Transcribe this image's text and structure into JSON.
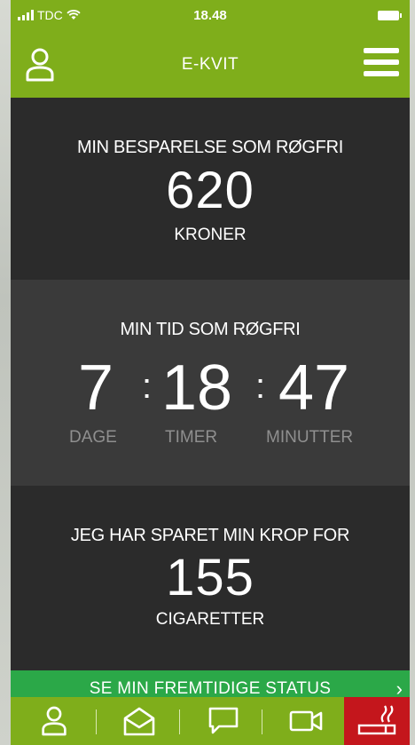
{
  "status_bar": {
    "carrier": "TDC",
    "time": "18.48"
  },
  "header": {
    "title": "E-KVIT",
    "icons": {
      "left": "user-icon",
      "right": "hamburger-menu-icon"
    }
  },
  "savings": {
    "title": "MIN BESPARELSE SOM RØGFRI",
    "value": "620",
    "unit": "KRONER"
  },
  "smoke_free_time": {
    "title": "MIN TID SOM RØGFRI",
    "days": "7",
    "hours": "18",
    "minutes": "47",
    "separator": ":",
    "days_label": "DAGE",
    "hours_label": "TIMER",
    "minutes_label": "MINUTTER"
  },
  "body_saved": {
    "title": "JEG HAR SPARET MIN KROP FOR",
    "value": "155",
    "unit": "CIGARETTER"
  },
  "future_status": {
    "label": "SE MIN FREMTIDIGE STATUS",
    "arrow": "›"
  },
  "tab_bar": {
    "tabs": [
      {
        "icon": "user-icon"
      },
      {
        "icon": "envelope-open-icon"
      },
      {
        "icon": "chat-bubble-icon"
      },
      {
        "icon": "video-camera-icon"
      },
      {
        "icon": "cigarette-icon"
      }
    ]
  },
  "colors": {
    "brand_green": "#7fae1b",
    "banner_green": "#2ba848",
    "smoke_red": "#c4161c",
    "dark_bg": "#2b2b2b",
    "mid_bg": "#3a3a3a",
    "muted_label": "#8f8f8f"
  }
}
